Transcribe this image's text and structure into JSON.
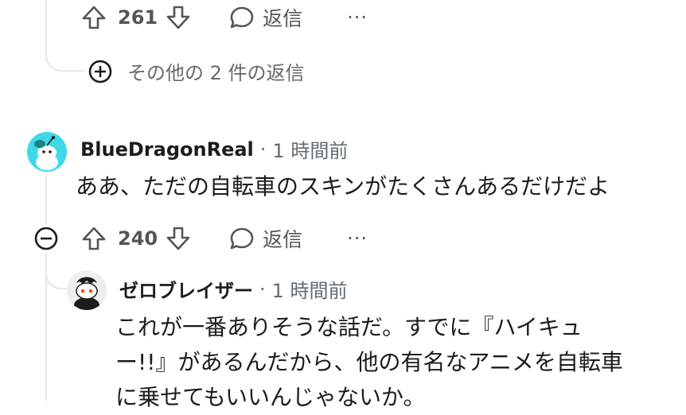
{
  "comment_top": {
    "vote_count": "261",
    "reply_label": "返信",
    "more_label": "···",
    "more_replies_label": "その他の 2 件の返信"
  },
  "comment_main": {
    "username": "BlueDragonReal",
    "separator": "·",
    "time": "1 時間前",
    "body": "ああ、ただの自転車のスキンがたくさんあるだけだよ",
    "vote_count": "240",
    "reply_label": "返信",
    "more_label": "···"
  },
  "comment_reply": {
    "username": "ゼロブレイザー",
    "separator": "·",
    "time": "1 時間前",
    "body_lines": [
      "これが一番ありそうな話だ。すでに『ハイキュ",
      "ー!!』があるんだから、他の有名なアニメを自転車",
      "に乗せてもいいんじゃないか。"
    ]
  },
  "colors": {
    "thread_line": "#e6e6e6",
    "avatar_cyan": "#3fd8e6",
    "text_primary": "#1c1c1c",
    "text_secondary": "#555555"
  }
}
